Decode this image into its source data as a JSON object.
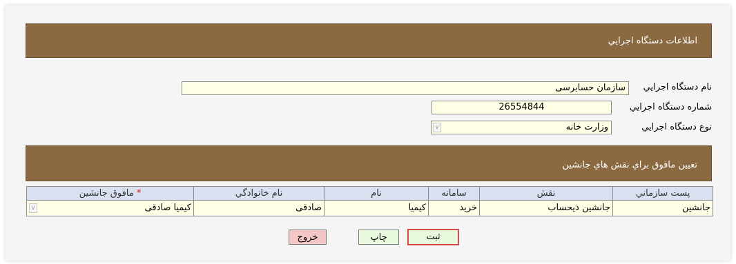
{
  "section1": {
    "title": "اطلاعات دستگاه اجرایي"
  },
  "org": {
    "name_label": "نام دستگاه اجرایي",
    "name_value": "سازمان حسابرسی",
    "number_label": "شماره دستگاه اجرایي",
    "number_value": "26554844",
    "type_label": "نوع دستگاه اجرایي",
    "type_value": "وزارت خانه"
  },
  "section2": {
    "title": "تعيين مافوق براي نقش هاي جانشين"
  },
  "grid": {
    "columns": {
      "post": "پست سازماني",
      "role": "نقش",
      "system": "سامانه",
      "first_name": "نام",
      "last_name": "نام خانوادگي",
      "superior_req": "*",
      "superior": "مافوق جانشين"
    },
    "row": {
      "post": "جانشين",
      "role": "جانشين ذيحساب",
      "system": "خريد",
      "first_name": "كيميا",
      "last_name": "صادقی",
      "superior": "كيميا صادقی"
    }
  },
  "buttons": {
    "save": "ثبت",
    "print": "چاپ",
    "exit": "خروج"
  },
  "icons": {
    "dropdown": "chevron-down-icon"
  }
}
